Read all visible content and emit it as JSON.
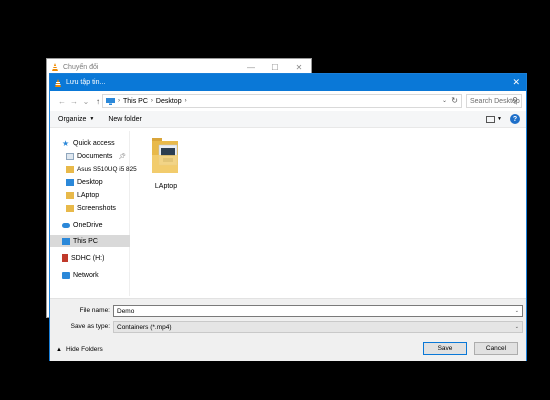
{
  "background_window": {
    "title": "Chuyển đổi",
    "controls": [
      "—",
      "☐",
      "✕"
    ]
  },
  "dialog": {
    "title": "Lưu tập tin...",
    "close": "✕",
    "nav": {
      "back": "←",
      "forward": "→",
      "recent": "⌄",
      "up": "↑"
    },
    "address": {
      "segments": [
        "This PC",
        "Desktop"
      ],
      "separator": "›"
    },
    "search_placeholder": "Search Desktop",
    "toolbar": {
      "organize": "Organize",
      "new_folder": "New folder",
      "help": "?"
    },
    "nav_pane": [
      {
        "label": "Quick access",
        "icon": "star-icon"
      },
      {
        "label": "Documents",
        "icon": "documents-icon",
        "pinned": true
      },
      {
        "label": "Asus S510UQ i5 825",
        "icon": "folder-icon"
      },
      {
        "label": "Desktop",
        "icon": "desktop-folder-icon"
      },
      {
        "label": "LAptop",
        "icon": "folder-icon"
      },
      {
        "label": "Screenshots",
        "icon": "folder-icon"
      },
      {
        "label": "OneDrive",
        "icon": "cloud-icon"
      },
      {
        "label": "This PC",
        "icon": "computer-icon",
        "selected": true
      },
      {
        "label": "SDHC (H:)",
        "icon": "sd-card-icon"
      },
      {
        "label": "Network",
        "icon": "network-icon"
      }
    ],
    "files": [
      {
        "name": "LAptop",
        "icon": "folder-icon"
      }
    ],
    "file_name_label": "File name:",
    "file_name_value": "Demo",
    "save_as_type_label": "Save as type:",
    "save_as_type_value": "Containers (*.mp4)",
    "hide_folders": "Hide Folders",
    "save_button": "Save",
    "cancel_button": "Cancel"
  },
  "colors": {
    "accent": "#0a78d7",
    "folder": "#e8b94a",
    "selection": "#d9d9d9"
  }
}
